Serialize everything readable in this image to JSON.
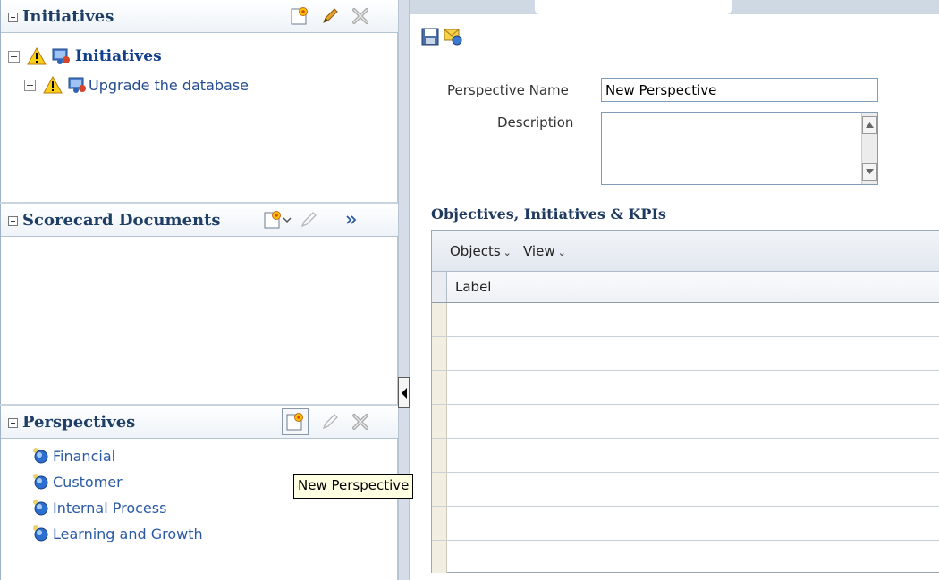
{
  "initiatives_panel": {
    "title": "Initiatives",
    "tree": [
      {
        "label": "Initiatives",
        "status": "warning"
      },
      {
        "label": "Upgrade the database",
        "status": "warning"
      }
    ]
  },
  "scorecard_panel": {
    "title": "Scorecard Documents"
  },
  "perspectives_panel": {
    "title": "Perspectives",
    "items": [
      "Financial",
      "Customer",
      "Internal Process",
      "Learning and Growth"
    ]
  },
  "tooltip": "New Perspective",
  "form": {
    "name_label": "Perspective Name",
    "name_value": "New Perspective",
    "description_label": "Description",
    "description_value": ""
  },
  "objectives": {
    "title": "Objectives, Initiatives & KPIs",
    "menus": [
      "Objects",
      "View"
    ],
    "column": "Label",
    "rows": [
      "",
      "",
      "",
      "",
      "",
      "",
      "",
      ""
    ]
  },
  "colors": {
    "header_text": "#1f3e66",
    "link": "#2b5aa4",
    "tooltip_bg": "#ffffe1"
  }
}
